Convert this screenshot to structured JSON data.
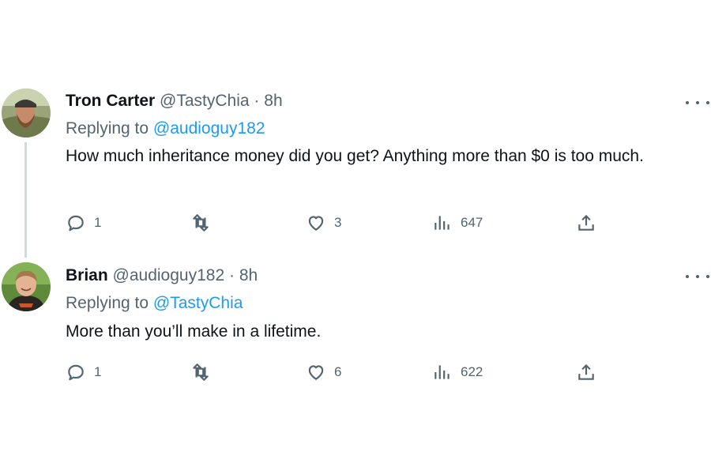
{
  "tweets": [
    {
      "name": "Tron Carter",
      "handle": "@TastyChia",
      "dot": "·",
      "time": "8h",
      "reply_prefix": "Replying to",
      "reply_to": "@audioguy182",
      "text": "How much inheritance money did you get? Anything more than $0 is too much.",
      "replies": "1",
      "retweets": "",
      "likes": "3",
      "views": "647",
      "avatar_icon": "bearded-man-avatar"
    },
    {
      "name": "Brian",
      "handle": "@audioguy182",
      "dot": "·",
      "time": "8h",
      "reply_prefix": "Replying to",
      "reply_to": "@TastyChia",
      "text": "More than you’ll make in a lifetime.",
      "replies": "1",
      "retweets": "",
      "likes": "6",
      "views": "622",
      "avatar_icon": "smiling-man-avatar"
    }
  ],
  "icons": {
    "reply": "reply-icon",
    "retweet": "retweet-icon",
    "like": "heart-icon",
    "views": "views-icon",
    "share": "share-icon",
    "more": "more-icon"
  },
  "colors": {
    "text": "#0f1419",
    "secondary": "#536471",
    "accent": "#1d9bf0",
    "thread_line": "#cfd9de"
  }
}
